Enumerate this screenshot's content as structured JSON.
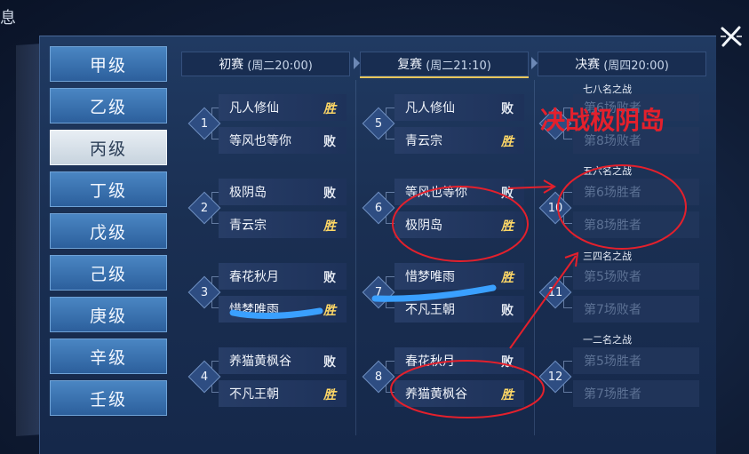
{
  "corner_char": "息",
  "grade_tabs": [
    "甲级",
    "乙级",
    "丙级",
    "丁级",
    "戊级",
    "己级",
    "庚级",
    "辛级",
    "壬级"
  ],
  "active_tab": "丙级",
  "rounds": [
    {
      "name": "初赛",
      "time": "(周二20:00)"
    },
    {
      "name": "复赛",
      "time": "(周二21:10)"
    },
    {
      "name": "决赛",
      "time": "(周四20:00)"
    }
  ],
  "round1": [
    {
      "num": "1",
      "teams": [
        {
          "name": "凡人修仙",
          "result": "胜"
        },
        {
          "name": "等风也等你",
          "result": "败"
        }
      ]
    },
    {
      "num": "2",
      "teams": [
        {
          "name": "极阴岛",
          "result": "败"
        },
        {
          "name": "青云宗",
          "result": "胜"
        }
      ]
    },
    {
      "num": "3",
      "teams": [
        {
          "name": "春花秋月",
          "result": "败"
        },
        {
          "name": "惜梦唯雨",
          "result": "胜"
        }
      ]
    },
    {
      "num": "4",
      "teams": [
        {
          "name": "养猫黄枫谷",
          "result": "败"
        },
        {
          "name": "不凡王朝",
          "result": "胜"
        }
      ]
    }
  ],
  "round2": [
    {
      "num": "5",
      "teams": [
        {
          "name": "凡人修仙",
          "result": "败"
        },
        {
          "name": "青云宗",
          "result": "胜"
        }
      ]
    },
    {
      "num": "6",
      "teams": [
        {
          "name": "等风也等你",
          "result": "败"
        },
        {
          "name": "极阴岛",
          "result": "胜"
        }
      ]
    },
    {
      "num": "7",
      "teams": [
        {
          "name": "惜梦唯雨",
          "result": "胜"
        },
        {
          "name": "不凡王朝",
          "result": "败"
        }
      ]
    },
    {
      "num": "8",
      "teams": [
        {
          "name": "春花秋月",
          "result": "败"
        },
        {
          "name": "养猫黄枫谷",
          "result": "胜"
        }
      ]
    }
  ],
  "finals": [
    {
      "num": "",
      "label": "七八名之战",
      "slots": [
        "第6场败者",
        "第8场败者"
      ]
    },
    {
      "num": "10",
      "label": "五六名之战",
      "slots": [
        "第6场胜者",
        "第8场胜者"
      ]
    },
    {
      "num": "11",
      "label": "三四名之战",
      "slots": [
        "第5场败者",
        "第7场败者"
      ]
    },
    {
      "num": "12",
      "label": "一二名之战",
      "slots": [
        "第5场胜者",
        "第7场胜者"
      ]
    }
  ],
  "annotation": {
    "text": "决战极阴岛",
    "color": "#e4202c"
  },
  "colors": {
    "win": "#ffd866",
    "accent_blue": "#4a86c3",
    "annotation_red": "#e4202c",
    "highlight_blue": "#3aa0ff"
  },
  "icons": {
    "close": "close-x-icon"
  }
}
